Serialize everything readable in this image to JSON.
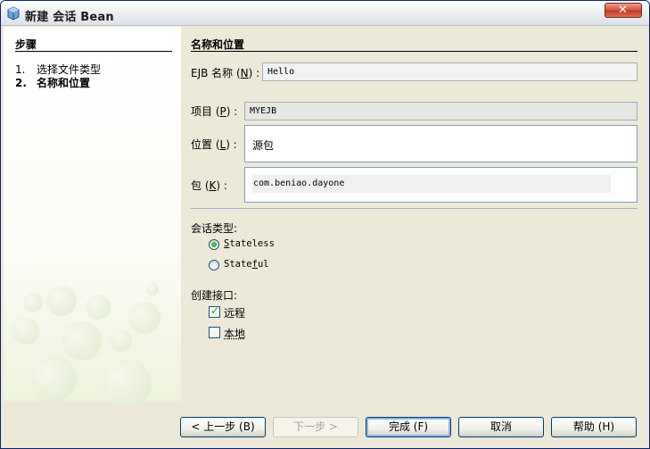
{
  "window": {
    "title": "新建 会话 Bean",
    "title_icon": "netbeans-cube-icon",
    "close_icon": "close-icon"
  },
  "steps": {
    "heading": "步骤",
    "items": [
      {
        "number": "1.",
        "label": "选择文件类型",
        "current": false
      },
      {
        "number": "2.",
        "label": "名称和位置",
        "current": true
      }
    ]
  },
  "form": {
    "heading": "名称和位置",
    "ejb_name": {
      "label_pre": "EJB 名称 (",
      "mnemonic": "N",
      "label_post": ") :",
      "value": "Hello"
    },
    "project": {
      "label_pre": "项目 (",
      "mnemonic": "P",
      "label_post": ") :",
      "value": "MYEJB"
    },
    "location": {
      "label_pre": "位置 (",
      "mnemonic": "L",
      "label_post": ") :",
      "value": "源包"
    },
    "package": {
      "label_pre": "包 (",
      "mnemonic": "K",
      "label_post": ") :",
      "value": "com.beniao.dayone"
    },
    "session_type": {
      "label": "会话类型:",
      "options": [
        {
          "mnemonic": "S",
          "rest": "tateless",
          "selected": true
        },
        {
          "pre": "State",
          "mnemonic": "f",
          "rest": "ul",
          "selected": false
        }
      ]
    },
    "interfaces": {
      "label": "创建接口:",
      "options": [
        {
          "label": "远程",
          "checked": true
        },
        {
          "label": "本地",
          "checked": false
        }
      ]
    }
  },
  "buttons": {
    "back": "< 上一步 (B)",
    "next": "下一步 >",
    "finish": "完成 (F)",
    "cancel": "取消",
    "help": "帮助 (H)"
  },
  "colors": {
    "titlebar_border": "#0a246a",
    "close_button": "#c23a1c",
    "radio_selected": "#21a121",
    "checkbox_mark": "#21a121"
  }
}
